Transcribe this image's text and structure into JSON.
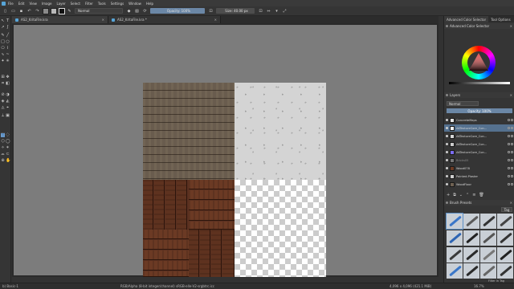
{
  "menubar": {
    "items": [
      "File",
      "Edit",
      "View",
      "Image",
      "Layer",
      "Select",
      "Filter",
      "Tools",
      "Settings",
      "Window",
      "Help"
    ]
  },
  "toolbar": {
    "blend_mode": "Normal",
    "opacity": "Opacity: 100%",
    "size": "Size: 40.00 px"
  },
  "tabs": [
    {
      "label": "AS2_KritaFile.kra"
    },
    {
      "label": "AS2_KritaFile.kra *"
    }
  ],
  "status": {
    "brush": "b) Basic-1",
    "color_info": "RGB/Alpha (8-bit integer/channel)  sRGB-elle-V2-srgbtrc.icc",
    "dimensions": "4,096 x 4,096 (421.1 MiB)",
    "zoom": "16.7%"
  },
  "right_panel": {
    "tabs": [
      "Advanced Color Selector",
      "Tool Options"
    ],
    "color_docker_title": "Advanced Color Selector",
    "layers_title": "Layers",
    "layers_blend": "Normal",
    "layers_opacity": "Opacity:  100%",
    "layers": [
      {
        "name": "ConcreteMaps",
        "selected": false,
        "dim": false,
        "thumb": "#e6e6e6"
      },
      {
        "name": "AKTextureCore_Con...",
        "selected": true,
        "dim": false,
        "thumb": "#f0f0f0"
      },
      {
        "name": "AKTextureCore_Con...",
        "selected": false,
        "dim": false,
        "thumb": "#d8d8d8"
      },
      {
        "name": "AKTextureCore_Con...",
        "selected": false,
        "dim": false,
        "thumb": "#cccccc"
      },
      {
        "name": "AKTextureCore_Con...",
        "selected": false,
        "dim": false,
        "thumb": "#7b6cf0"
      },
      {
        "name": "Bricks05",
        "selected": false,
        "dim": true,
        "thumb": "#777777"
      },
      {
        "name": "Wood078",
        "selected": false,
        "dim": false,
        "thumb": "#6b3a24"
      },
      {
        "name": "Painted-Plaster",
        "selected": false,
        "dim": false,
        "thumb": "#cfcfcf"
      },
      {
        "name": "WoodFloor",
        "selected": false,
        "dim": false,
        "thumb": "#6f6253"
      }
    ],
    "presets_title": "Brush Presets",
    "presets_tag": "Tag",
    "presets_filter": "Filter in Tag",
    "preset_colors": [
      "#3a76c8",
      "#5a5a5a",
      "#333333",
      "#444444",
      "#2d64b3",
      "#222222",
      "#555555",
      "#333333",
      "#3a3a3a",
      "#2a2a2a",
      "#777777",
      "#222222",
      "#3a76c8",
      "#2a2a2a",
      "#666666",
      "#333333"
    ]
  },
  "colors": {
    "accent": "#5b8fc4",
    "opacity_bar": "#6b87a6",
    "canvas_bg": "#7c7c7c"
  }
}
